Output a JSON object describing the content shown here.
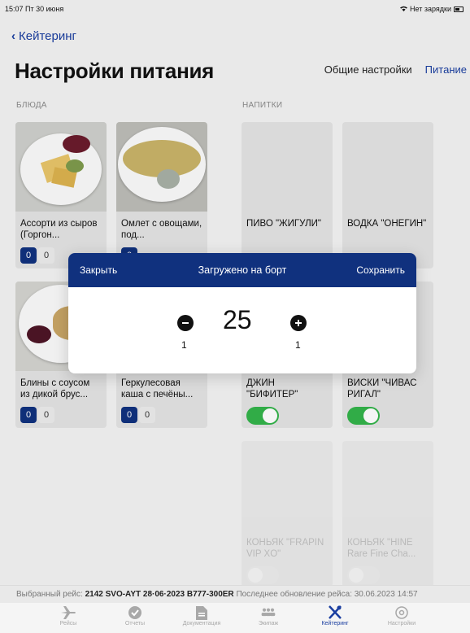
{
  "status": {
    "time": "15:07  Пт 30 июня",
    "battery_text": "Нет зарядки"
  },
  "nav": {
    "back_label": "Кейтеринг"
  },
  "page_title": "Настройки питания",
  "top_tabs": [
    {
      "label": "Общие настройки",
      "active": false
    },
    {
      "label": "Питание",
      "active": true
    }
  ],
  "sections": {
    "dishes": "БЛЮДА",
    "drinks": "НАПИТКИ"
  },
  "dishes": [
    {
      "name": "Ассорти из сыров (Горгон...",
      "loaded": "0",
      "free": "0"
    },
    {
      "name": "Омлет с овощами, под...",
      "loaded": "0",
      "free": ""
    },
    {
      "name": "Блины с соусом из дикой брус...",
      "loaded": "0",
      "free": "0"
    },
    {
      "name": "Геркулесовая каша с печёны...",
      "loaded": "0",
      "free": "0"
    }
  ],
  "drinks": [
    {
      "name": "ПИВО \"ЖИГУЛИ\"",
      "enabled": true
    },
    {
      "name": "ВОДКА \"ОНЕГИН\"",
      "enabled": true
    },
    {
      "name": "ДЖИН \"БИФИТЕР\"",
      "enabled": true
    },
    {
      "name": "ВИСКИ \"ЧИВАС РИГАЛ\"",
      "enabled": true
    },
    {
      "name": "КОНЬЯК \"FRAPIN VIP XO\"",
      "enabled": false
    },
    {
      "name": "КОНЬЯК \"HINE Rare Fine Cha...",
      "enabled": false
    }
  ],
  "modal": {
    "close_label": "Закрыть",
    "title": "Загружено на борт",
    "save_label": "Сохранить",
    "value": "25",
    "minus_step": "1",
    "plus_step": "1"
  },
  "info_bar": {
    "prefix": "Выбранный рейс:",
    "flight": "2142 SVO-AYT 28·06·2023 B777-300ER",
    "update_label": "Последнее обновление рейса: 30.06.2023 14:57"
  },
  "tab_bar": [
    {
      "label": "Рейсы",
      "icon": "plane-icon",
      "active": false
    },
    {
      "label": "Отчеты",
      "icon": "check-circle-icon",
      "active": false
    },
    {
      "label": "Документация",
      "icon": "document-icon",
      "active": false
    },
    {
      "label": "Экипаж",
      "icon": "crew-icon",
      "active": false
    },
    {
      "label": "Кейтеринг",
      "icon": "catering-icon",
      "active": true
    },
    {
      "label": "Настройки",
      "icon": "settings-icon",
      "active": false
    }
  ],
  "colors": {
    "primary": "#10317e",
    "link": "#1a3ea0",
    "toggle_on": "#34b34a"
  }
}
